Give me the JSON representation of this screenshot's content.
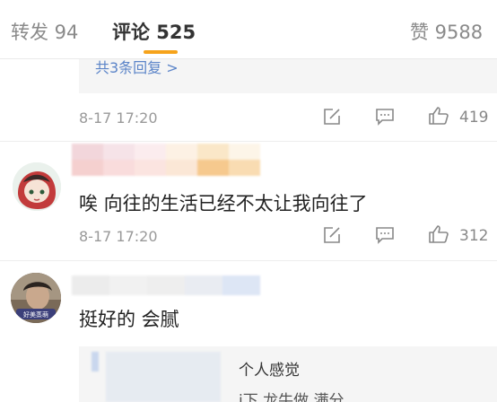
{
  "tabs": [
    {
      "label": "转发 94"
    },
    {
      "label": "评论 525"
    },
    {
      "label": "赞 9588"
    }
  ],
  "reply_link": "共3条回复 >",
  "comments": [
    {
      "time": "8-17 17:20",
      "likes": "419"
    },
    {
      "time": "8-17 17:20",
      "likes": "312",
      "text": "唉 向往的生活已经不太让我向往了"
    },
    {
      "text": "挺好的 会腻",
      "sub_reply": "个人感觉",
      "sub_reply_partial": "i下 龙牛做 满分",
      "avatar_badge": "好美蒸萌"
    }
  ],
  "colors": {
    "accent": "#f6a31b",
    "link": "#5b84c8",
    "meta": "#999999"
  }
}
